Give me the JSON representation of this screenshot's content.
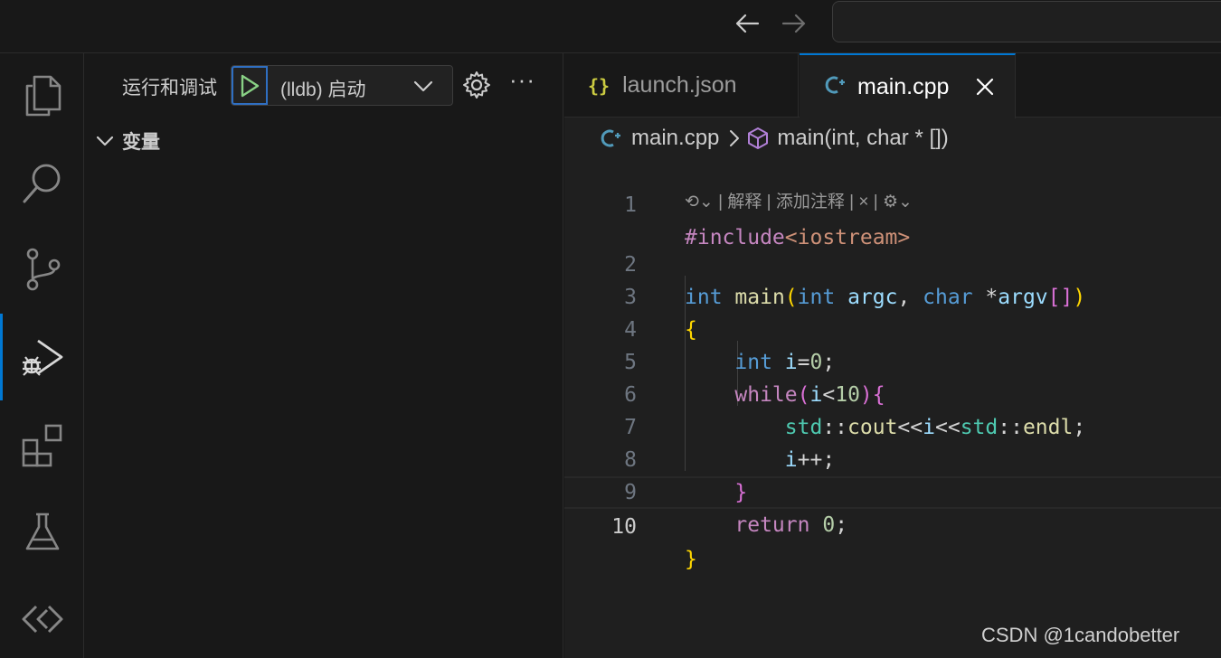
{
  "sidebar": {
    "title": "运行和调试",
    "config_label": "(lldb) 启动",
    "section_variables": "变量"
  },
  "tabs": [
    {
      "icon": "{}",
      "label": "launch.json"
    },
    {
      "icon": "G+",
      "label": "main.cpp",
      "active": true
    }
  ],
  "breadcrumb": {
    "file": "main.cpp",
    "symbol": "main(int, char * [])"
  },
  "editor": {
    "codelens": "| 解释 | 添加注释 |",
    "current_line": 10,
    "line_numbers": [
      "1",
      "2",
      "3",
      "4",
      "5",
      "6",
      "7",
      "8",
      "9",
      "10"
    ],
    "lines": [
      "#include<iostream>",
      "int main(int argc, char *argv[])",
      "{",
      "    int i=0;",
      "    while(i<10){",
      "        std::cout<<i<<std::endl;",
      "        i++;",
      "    }",
      "    return 0;",
      "}"
    ]
  },
  "watermark": "CSDN @1candobetter",
  "colors": {
    "accent": "#0078d4",
    "run_icon": "#89d185",
    "json_icon": "#cbcb41",
    "cpp_icon": "#519aba"
  }
}
